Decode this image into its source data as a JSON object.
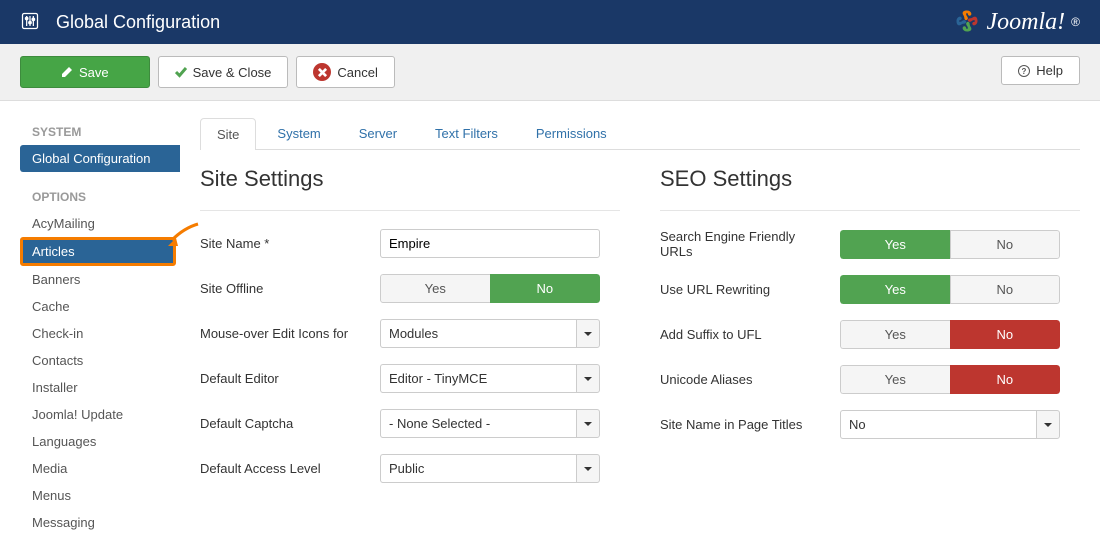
{
  "header": {
    "title": "Global Configuration",
    "brand": "Joomla!"
  },
  "toolbar": {
    "save": "Save",
    "save_close": "Save & Close",
    "cancel": "Cancel",
    "help": "Help"
  },
  "sidebar": {
    "system_heading": "SYSTEM",
    "global_config": "Global Configuration",
    "options_heading": "OPTIONS",
    "items": [
      "AcyMailing",
      "Articles",
      "Banners",
      "Cache",
      "Check-in",
      "Contacts",
      "Installer",
      "Joomla! Update",
      "Languages",
      "Media",
      "Menus",
      "Messaging"
    ]
  },
  "tabs": [
    "Site",
    "System",
    "Server",
    "Text Filters",
    "Permissions"
  ],
  "site": {
    "section": "Site Settings",
    "labels": {
      "site_name": "Site Name *",
      "site_offline": "Site Offline",
      "mouse_over": "Mouse-over Edit Icons for",
      "default_editor": "Default Editor",
      "default_captcha": "Default Captcha",
      "default_access": "Default Access Level"
    },
    "values": {
      "site_name": "Empire",
      "mouse_over": "Modules",
      "default_editor": "Editor - TinyMCE",
      "default_captcha": "- None Selected -",
      "default_access": "Public"
    }
  },
  "seo": {
    "section": "SEO Settings",
    "labels": {
      "sef_urls": "Search Engine Friendly URLs",
      "url_rewriting": "Use URL Rewriting",
      "add_suffix": "Add Suffix to UFL",
      "unicode": "Unicode Aliases",
      "page_titles": "Site Name in Page Titles"
    },
    "values": {
      "page_titles": "No"
    }
  },
  "yn": {
    "yes": "Yes",
    "no": "No"
  }
}
